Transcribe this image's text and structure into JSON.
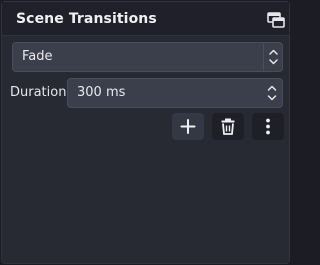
{
  "dock": {
    "title": "Scene Transitions",
    "float_icon": "undock-icon"
  },
  "transition": {
    "selected": "Fade",
    "icon": "up-down-arrows-icon"
  },
  "duration": {
    "label": "Duration",
    "value": "300 ms",
    "icon": "spin-arrows-icon"
  },
  "toolbar": {
    "add_icon": "plus-icon",
    "remove_icon": "trash-icon",
    "menu_icon": "vertical-dots-icon"
  },
  "colors": {
    "panel_bg": "#272933",
    "titlebar_bg": "#1f2029",
    "input_bg": "#3b3e4b",
    "text": "#e9e9ee"
  }
}
